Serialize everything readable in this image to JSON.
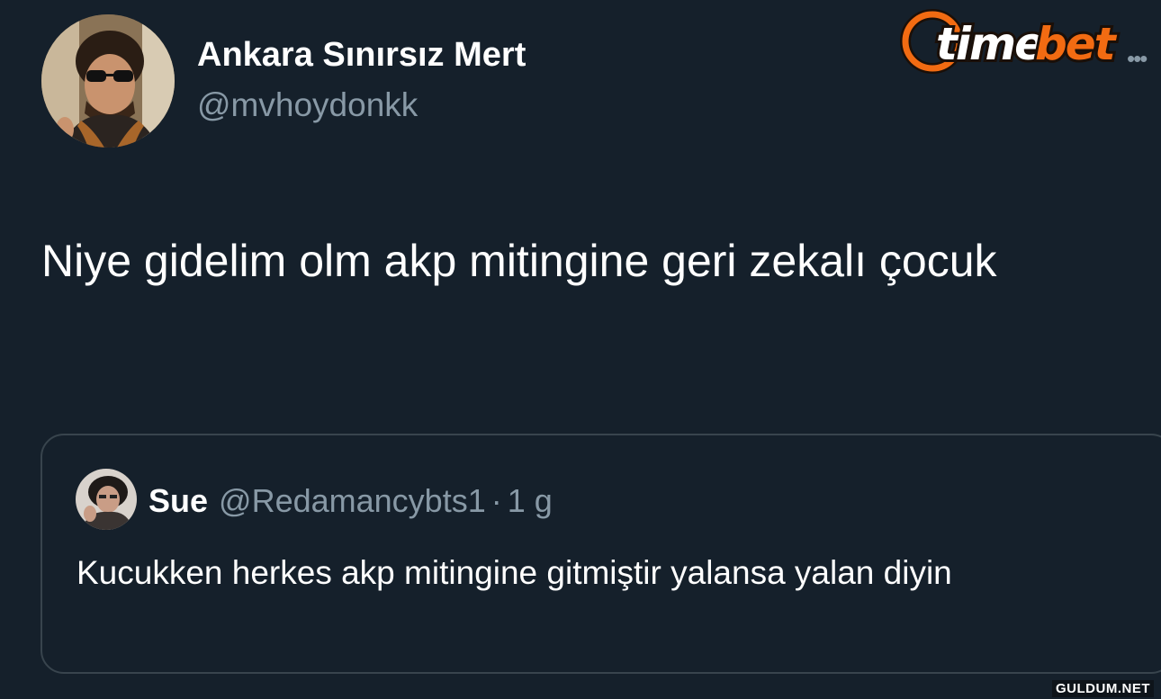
{
  "tweet": {
    "author": {
      "display_name": "Ankara Sınırsız Mert",
      "handle": "@mvhoydonkk"
    },
    "text": "Niye gidelim olm akp mitingine geri zekalı çocuk",
    "more_icon": "more-horizontal-icon"
  },
  "quoted_tweet": {
    "author": {
      "display_name": "Sue",
      "handle": "@Redamancybts1"
    },
    "separator": "·",
    "time": "1 g",
    "text": "Kucukken herkes akp mitingine gitmiştir yalansa yalan diyin"
  },
  "watermarks": {
    "logo_text": "timebet",
    "site": "GULDUM.NET"
  },
  "colors": {
    "background": "#15202b",
    "primary_text": "#ffffff",
    "secondary_text": "#8899a6",
    "border": "#38444d",
    "logo_orange": "#f26b12"
  }
}
